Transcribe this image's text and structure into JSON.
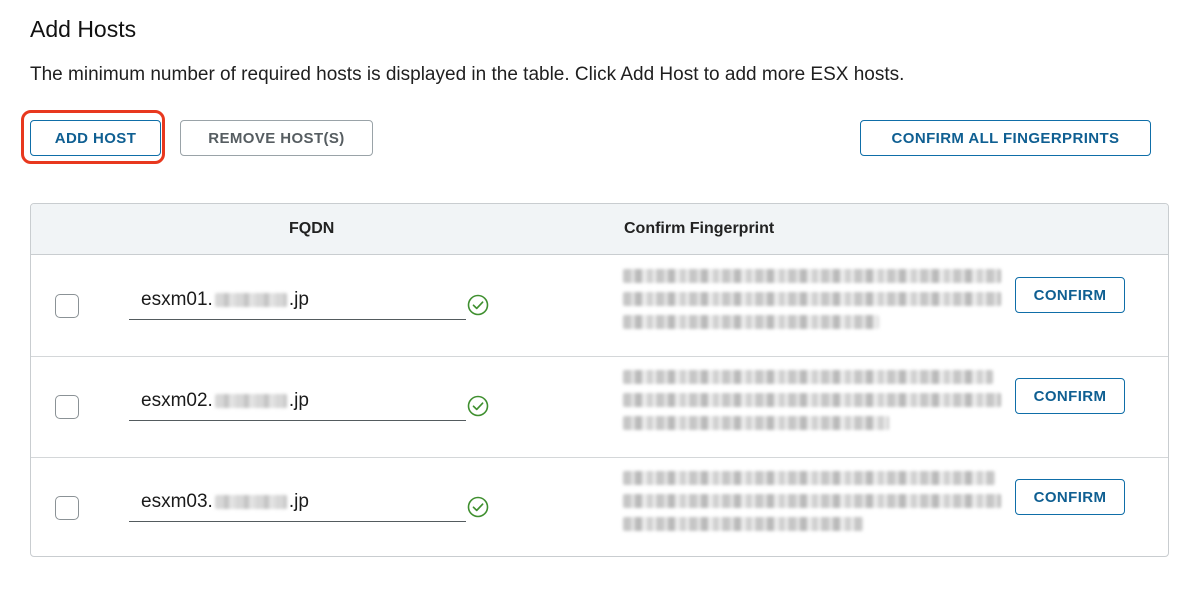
{
  "header": {
    "title": "Add Hosts",
    "description": "The minimum number of required hosts is displayed in the table. Click Add Host to add more ESX hosts."
  },
  "toolbar": {
    "add_host_label": "ADD HOST",
    "remove_hosts_label": "REMOVE HOST(S)",
    "confirm_all_label": "CONFIRM ALL FINGERPRINTS"
  },
  "table": {
    "columns": [
      "FQDN",
      "Confirm Fingerprint"
    ],
    "rows": [
      {
        "fqdn_prefix": "esxm01.",
        "fqdn_suffix": ".jp",
        "confirm_label": "CONFIRM",
        "valid": true,
        "checked": false
      },
      {
        "fqdn_prefix": "esxm02.",
        "fqdn_suffix": ".jp",
        "confirm_label": "CONFIRM",
        "valid": true,
        "checked": false
      },
      {
        "fqdn_prefix": "esxm03.",
        "fqdn_suffix": ".jp",
        "confirm_label": "CONFIRM",
        "valid": true,
        "checked": false
      }
    ]
  },
  "colors": {
    "accent": "#0f6ea8",
    "highlight": "#e8381e",
    "valid": "#3f8f2f"
  },
  "icons": {
    "valid": "check-circle-icon"
  }
}
